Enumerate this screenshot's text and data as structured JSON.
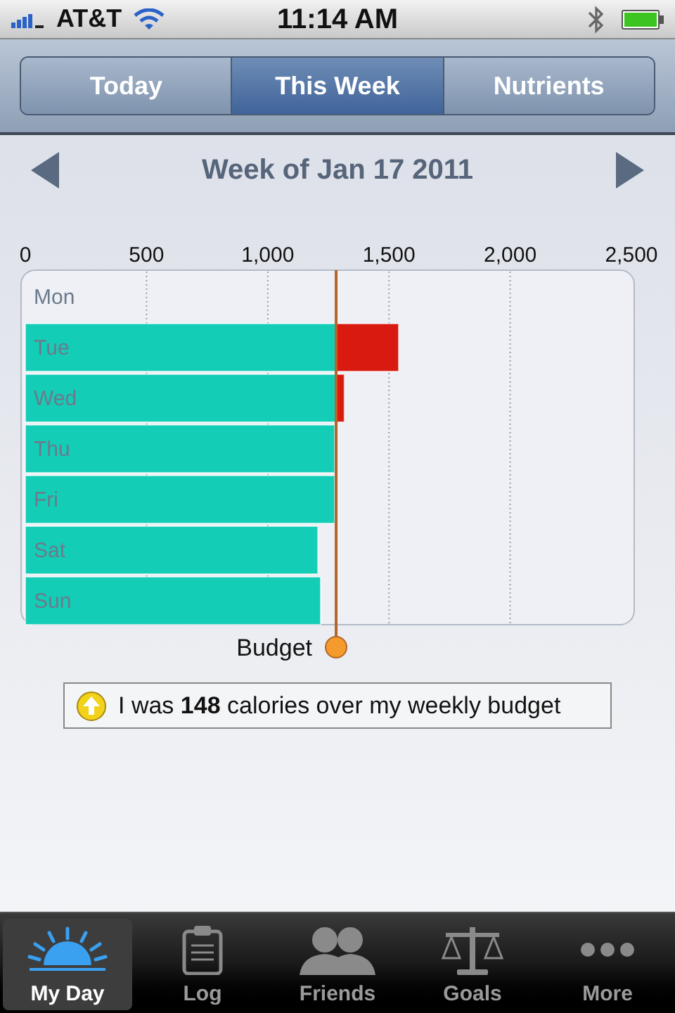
{
  "status_bar": {
    "carrier": "AT&T",
    "time": "11:14 AM"
  },
  "segments": [
    {
      "label": "Today",
      "selected": false
    },
    {
      "label": "This Week",
      "selected": true
    },
    {
      "label": "Nutrients",
      "selected": false
    }
  ],
  "week_nav": {
    "title": "Week of Jan 17 2011"
  },
  "chart": {
    "chart_data": {
      "type": "bar",
      "orientation": "horizontal",
      "stacked": true,
      "categories": [
        "Mon",
        "Tue",
        "Wed",
        "Thu",
        "Fri",
        "Sat",
        "Sun"
      ],
      "series": [
        {
          "color": "#14cdb6",
          "values": [
            0,
            1282,
            1282,
            1276,
            1276,
            1207,
            1218
          ]
        },
        {
          "color": "#d81a10",
          "values": [
            0,
            258,
            34,
            0,
            0,
            0,
            0
          ]
        }
      ],
      "xlim": [
        0,
        2500
      ],
      "xticks": [
        0,
        {
          "value": 500,
          "label": "500"
        },
        {
          "value": 1000,
          "label": "1,000"
        },
        {
          "value": 1500,
          "label": "1,500"
        },
        {
          "value": 2000,
          "label": "2,000"
        },
        {
          "value": 2500,
          "label": "2,500"
        }
      ],
      "grid": true,
      "ref_lines": [
        {
          "axis": "x",
          "value": 1282,
          "label": "Budget"
        }
      ]
    }
  },
  "summary": {
    "text": "I was **148** calories over my weekly budget",
    "kind": "over"
  },
  "tab_bar": [
    {
      "label": "My Day",
      "kind": "sunrise",
      "selected": true
    },
    {
      "label": "Log",
      "kind": "clipboard",
      "selected": false
    },
    {
      "label": "Friends",
      "kind": "people",
      "selected": false
    },
    {
      "label": "Goals",
      "kind": "scale",
      "selected": false
    },
    {
      "label": "More",
      "kind": "more",
      "selected": false
    }
  ]
}
